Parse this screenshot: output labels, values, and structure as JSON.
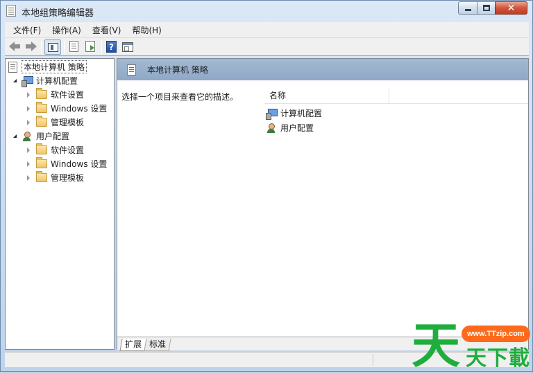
{
  "window": {
    "title": "本地组策略编辑器",
    "icon": "policy-editor-icon",
    "controls": {
      "minimize": "minimize-icon",
      "maximize": "maximize-icon",
      "close": "close-icon",
      "close_glyph": "✕"
    }
  },
  "menu": {
    "items": [
      {
        "label": "文件(F)"
      },
      {
        "label": "操作(A)"
      },
      {
        "label": "查看(V)"
      },
      {
        "label": "帮助(H)"
      }
    ]
  },
  "toolbar": {
    "buttons": [
      "back-arrow-icon",
      "forward-arrow-icon",
      "show-hide-tree-icon",
      "properties-icon",
      "export-list-icon",
      "help-icon",
      "show-action-pane-icon"
    ],
    "help_glyph": "?"
  },
  "tree": {
    "root": {
      "label": "本地计算机 策略",
      "selected": true
    },
    "computer_config": {
      "label": "计算机配置",
      "expanded": true,
      "children": [
        {
          "label": "软件设置"
        },
        {
          "label": "Windows 设置"
        },
        {
          "label": "管理模板"
        }
      ]
    },
    "user_config": {
      "label": "用户配置",
      "expanded": true,
      "children": [
        {
          "label": "软件设置"
        },
        {
          "label": "Windows 设置"
        },
        {
          "label": "管理模板"
        }
      ]
    }
  },
  "details": {
    "header_title": "本地计算机 策略",
    "description": "选择一个项目来查看它的描述。",
    "column_name": "名称",
    "items": [
      {
        "label": "计算机配置"
      },
      {
        "label": "用户配置"
      }
    ]
  },
  "tabs": [
    {
      "label": "扩展",
      "active": true
    },
    {
      "label": "标准",
      "active": false
    }
  ],
  "watermark": {
    "big": "天",
    "pill": "www.TTzip.com",
    "sub": "天下載"
  },
  "colors": {
    "header_band": "#a2b9d2",
    "watermark_green": "#1fae3d",
    "watermark_orange": "#ff6a1a",
    "close_red": "#c23b23"
  }
}
